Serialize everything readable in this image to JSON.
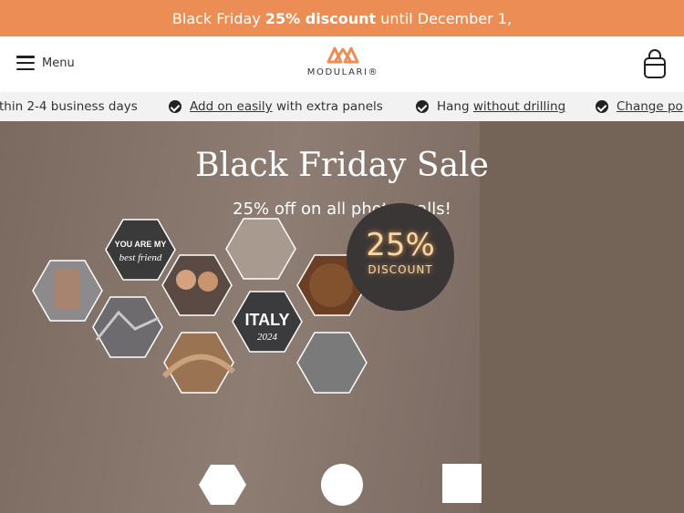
{
  "promo": {
    "prefix": "Black Friday",
    "bold": "25% discount",
    "suffix": "until December 1,"
  },
  "header": {
    "menu_label": "Menu",
    "logo_text": "MODULARI®",
    "logo_icon": "modulari-logo-icon",
    "cart_icon": "shopping-bag-icon"
  },
  "usps": [
    {
      "plain_before": "thin 2-4 business days",
      "link": "",
      "plain_after": ""
    },
    {
      "plain_before": "",
      "link": "Add on easily",
      "plain_after": "with extra panels"
    },
    {
      "plain_before": "Hang",
      "link": "without drilling",
      "plain_after": ""
    },
    {
      "plain_before": "",
      "link": "Change po",
      "plain_after": ""
    }
  ],
  "hero": {
    "title": "Black Friday Sale",
    "subtitle": "25% off on all photo walls!",
    "badge_percent": "25%",
    "badge_text": "DISCOUNT",
    "tile_texts": {
      "best_friend_line1": "YOU ARE MY",
      "best_friend_line2": "best friend",
      "italy_line1": "ITALY",
      "italy_line2": "2024"
    },
    "shape_icons": [
      "hexagon-shape-icon",
      "circle-shape-icon",
      "square-shape-icon"
    ]
  },
  "colors": {
    "promo_bg": "#ec8d55",
    "accent_orange": "#ec8d55",
    "usp_bg": "#f2f2f2",
    "hero_bg": "#857469",
    "badge_bg": "#3b3636",
    "badge_text": "#f6d7a8"
  }
}
